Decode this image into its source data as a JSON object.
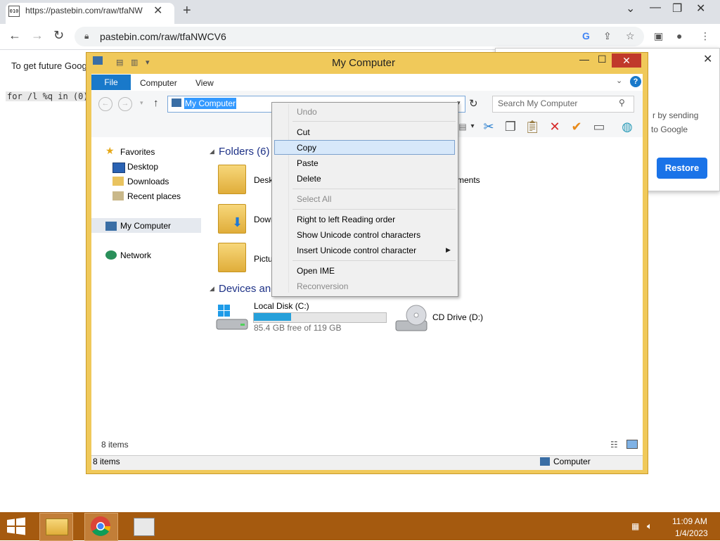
{
  "browser": {
    "tab_title": "https://pastebin.com/raw/tfaNW",
    "url": "pastebin.com/raw/tfaNWCV6",
    "infobar_text": "To get future Goog",
    "paste_content": "for /l %q in (0)"
  },
  "restore_popup": {
    "line1": "r by sending",
    "line2": "to Google",
    "button": "Restore"
  },
  "explorer": {
    "title": "My Computer",
    "ribbon_tabs": [
      "File",
      "Computer",
      "View"
    ],
    "address": "My Computer",
    "search_placeholder": "Search My Computer",
    "nav": {
      "favorites": "Favorites",
      "desktop": "Desktop",
      "downloads": "Downloads",
      "recent": "Recent places",
      "my_computer": "My Computer",
      "network": "Network"
    },
    "folders_header": "Folders (6)",
    "folders": [
      "Deskt",
      "Down",
      "Pictu"
    ],
    "folder_right_text": "ments",
    "devices_header": "Devices and",
    "disk_c": {
      "label": "Local Disk (C:)",
      "free": "85.4 GB free of 119 GB",
      "used_fraction": 0.28
    },
    "cd_drive": "CD Drive (D:)",
    "item_count": "8 items",
    "status_items": "8 items",
    "status_zone": "Computer"
  },
  "context_menu": {
    "undo": "Undo",
    "cut": "Cut",
    "copy": "Copy",
    "paste": "Paste",
    "delete": "Delete",
    "select_all": "Select All",
    "rtl": "Right to left Reading order",
    "show_unicode": "Show Unicode control characters",
    "insert_unicode": "Insert Unicode control character",
    "open_ime": "Open IME",
    "reconversion": "Reconversion"
  },
  "taskbar": {
    "time": "11:09 AM",
    "date": "1/4/2023"
  }
}
